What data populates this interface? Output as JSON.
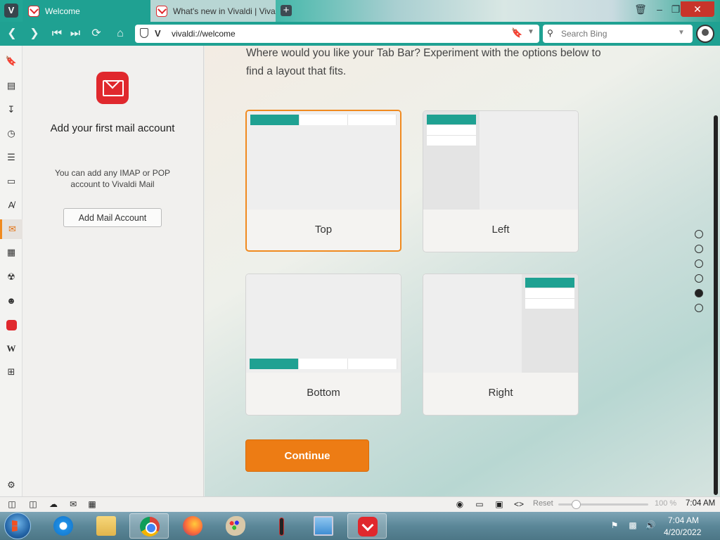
{
  "browser": {
    "tabs": [
      {
        "title": "Welcome",
        "active": true
      },
      {
        "title": "What's new in Vivaldi | Viva",
        "active": false
      }
    ],
    "address": {
      "brand_glyph": "V",
      "url": "vivaldi://welcome"
    },
    "search": {
      "placeholder": "Search Bing"
    }
  },
  "panel_icons": [
    "bookmark-icon",
    "reading-list-icon",
    "download-icon",
    "history-icon",
    "notes-icon",
    "window-icon",
    "translate-icon",
    "mail-icon",
    "calendar-icon",
    "feed-icon",
    "contacts-icon",
    "vivaldi-icon",
    "wikipedia-icon",
    "add-panel-icon",
    "settings-icon"
  ],
  "mail_panel": {
    "title": "Add your first mail account",
    "description": "You can add any IMAP or POP account to Vivaldi Mail",
    "button": "Add Mail Account"
  },
  "content": {
    "intro": "Where would you like your Tab Bar? Experiment with the options below to find a layout that fits.",
    "options": [
      {
        "id": "top",
        "label": "Top",
        "selected": true
      },
      {
        "id": "left",
        "label": "Left",
        "selected": false
      },
      {
        "id": "bottom",
        "label": "Bottom",
        "selected": false
      },
      {
        "id": "right",
        "label": "Right",
        "selected": false
      }
    ],
    "continue": "Continue",
    "step": {
      "total": 6,
      "current": 5
    }
  },
  "statusbar": {
    "reset": "Reset",
    "zoom": "100 %",
    "zoom_fraction": 0.16,
    "time": "7:04 AM"
  },
  "taskbar": {
    "apps": [
      "internet-explorer",
      "file-explorer",
      "chrome",
      "firefox",
      "paint",
      "stick-figure-app",
      "monitor-app",
      "vivaldi"
    ],
    "time": "7:04 AM",
    "date": "4/20/2022"
  },
  "colors": {
    "accent": "#1fa192",
    "button": "#ed7c14",
    "selected_border": "#f08a1f",
    "close": "#c8342a"
  }
}
